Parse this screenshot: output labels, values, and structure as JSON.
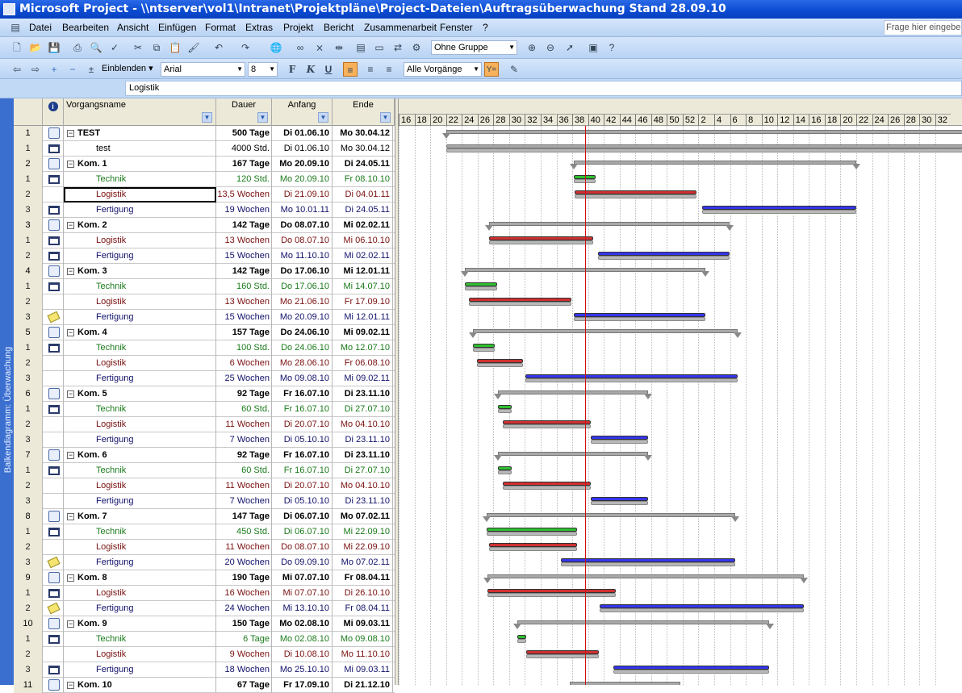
{
  "title": "Microsoft Project - \\\\ntserver\\vol1\\Intranet\\Projektpläne\\Project-Dateien\\Auftragsüberwachung Stand 28.09.10",
  "menu": [
    "Datei",
    "Bearbeiten",
    "Ansicht",
    "Einfügen",
    "Format",
    "Extras",
    "Projekt",
    "Bericht",
    "Zusammenarbeit",
    "Fenster",
    "?"
  ],
  "ask_placeholder": "Frage hier eingeben",
  "toolbar1": {
    "icons": [
      "new-icon",
      "open-icon",
      "save-icon",
      "print-icon",
      "print-preview-icon",
      "spellcheck-icon",
      "cut-icon",
      "copy-icon",
      "paste-icon",
      "format-painter-icon",
      "undo-icon",
      "redo-icon",
      "hyperlink-globe-icon",
      "link-tasks-icon",
      "unlink-tasks-icon",
      "split-task-icon",
      "task-info-icon",
      "task-notes-icon",
      "assign-resources-icon",
      "publish-icon"
    ],
    "group_value": "Ohne Gruppe",
    "icons_right": [
      "zoom-in-icon",
      "zoom-out-icon",
      "goto-task-icon",
      "copy-picture-icon",
      "help-icon"
    ]
  },
  "toolbar2": {
    "show_label": "Einblenden",
    "font_value": "Arial",
    "size_value": "8",
    "bold": "F",
    "italic": "K",
    "underline": "U",
    "filter_value": "Alle Vorgänge"
  },
  "entry_value": "Logistik",
  "view_label": "Balkendiagramm: Überwachung",
  "columns": {
    "name": "Vorgangsname",
    "duration": "Dauer",
    "start": "Anfang",
    "finish": "Ende"
  },
  "timescale": [
    "16",
    "18",
    "20",
    "22",
    "24",
    "26",
    "28",
    "30",
    "32",
    "34",
    "36",
    "38",
    "40",
    "42",
    "44",
    "46",
    "48",
    "50",
    "52",
    "2",
    "4",
    "6",
    "8",
    "10",
    "12",
    "14",
    "16",
    "18",
    "20",
    "22",
    "24",
    "26",
    "28",
    "30",
    "32"
  ],
  "colors": {
    "technik": "#2fbf2f",
    "logistik": "#d03030",
    "fertigung": "#3535ee",
    "summary": "#a8a8a8",
    "status_line": "#d01010"
  },
  "rows": [
    {
      "id": "1",
      "type": "summary",
      "icon": "sum",
      "name": "TEST",
      "duration": "500 Tage",
      "start": "Di 01.06.10",
      "finish": "Mo 30.04.12"
    },
    {
      "id": "1",
      "type": "plain",
      "icon": "cal",
      "name": "test",
      "duration": "4000 Std.",
      "start": "Di 01.06.10",
      "finish": "Mo 30.04.12"
    },
    {
      "id": "2",
      "type": "summary",
      "icon": "sum",
      "name": "Kom. 1",
      "duration": "167 Tage",
      "start": "Mo 20.09.10",
      "finish": "Di 24.05.11"
    },
    {
      "id": "1",
      "type": "technik",
      "icon": "cal",
      "name": "Technik",
      "duration": "120 Std.",
      "start": "Mo 20.09.10",
      "finish": "Fr 08.10.10"
    },
    {
      "id": "2",
      "type": "logistik",
      "icon": "",
      "name": "Logistik",
      "duration": "13,5 Wochen",
      "start": "Di 21.09.10",
      "finish": "Di 04.01.11",
      "selected": true
    },
    {
      "id": "3",
      "type": "fertigung",
      "icon": "cal",
      "name": "Fertigung",
      "duration": "19 Wochen",
      "start": "Mo 10.01.11",
      "finish": "Di 24.05.11"
    },
    {
      "id": "3",
      "type": "summary",
      "icon": "sum",
      "name": "Kom. 2",
      "duration": "142 Tage",
      "start": "Do 08.07.10",
      "finish": "Mi 02.02.11"
    },
    {
      "id": "1",
      "type": "logistik",
      "icon": "cal",
      "name": "Logistik",
      "duration": "13 Wochen",
      "start": "Do 08.07.10",
      "finish": "Mi 06.10.10"
    },
    {
      "id": "2",
      "type": "fertigung",
      "icon": "cal",
      "name": "Fertigung",
      "duration": "15 Wochen",
      "start": "Mo 11.10.10",
      "finish": "Mi 02.02.11"
    },
    {
      "id": "4",
      "type": "summary",
      "icon": "sum",
      "name": "Kom. 3",
      "duration": "142 Tage",
      "start": "Do 17.06.10",
      "finish": "Mi 12.01.11"
    },
    {
      "id": "1",
      "type": "technik",
      "icon": "cal",
      "name": "Technik",
      "duration": "160 Std.",
      "start": "Do 17.06.10",
      "finish": "Mi 14.07.10"
    },
    {
      "id": "2",
      "type": "logistik",
      "icon": "",
      "name": "Logistik",
      "duration": "13 Wochen",
      "start": "Mo 21.06.10",
      "finish": "Fr 17.09.10"
    },
    {
      "id": "3",
      "type": "fertigung",
      "icon": "note",
      "name": "Fertigung",
      "duration": "15 Wochen",
      "start": "Mo 20.09.10",
      "finish": "Mi 12.01.11"
    },
    {
      "id": "5",
      "type": "summary",
      "icon": "sum",
      "name": "Kom. 4",
      "duration": "157 Tage",
      "start": "Do 24.06.10",
      "finish": "Mi 09.02.11"
    },
    {
      "id": "1",
      "type": "technik",
      "icon": "cal",
      "name": "Technik",
      "duration": "100 Std.",
      "start": "Do 24.06.10",
      "finish": "Mo 12.07.10"
    },
    {
      "id": "2",
      "type": "logistik",
      "icon": "",
      "name": "Logistik",
      "duration": "6 Wochen",
      "start": "Mo 28.06.10",
      "finish": "Fr 06.08.10"
    },
    {
      "id": "3",
      "type": "fertigung",
      "icon": "",
      "name": "Fertigung",
      "duration": "25 Wochen",
      "start": "Mo 09.08.10",
      "finish": "Mi 09.02.11"
    },
    {
      "id": "6",
      "type": "summary",
      "icon": "sum",
      "name": "Kom. 5",
      "duration": "92 Tage",
      "start": "Fr 16.07.10",
      "finish": "Di 23.11.10"
    },
    {
      "id": "1",
      "type": "technik",
      "icon": "cal",
      "name": "Technik",
      "duration": "60 Std.",
      "start": "Fr 16.07.10",
      "finish": "Di 27.07.10"
    },
    {
      "id": "2",
      "type": "logistik",
      "icon": "",
      "name": "Logistik",
      "duration": "11 Wochen",
      "start": "Di 20.07.10",
      "finish": "Mo 04.10.10"
    },
    {
      "id": "3",
      "type": "fertigung",
      "icon": "",
      "name": "Fertigung",
      "duration": "7 Wochen",
      "start": "Di 05.10.10",
      "finish": "Di 23.11.10"
    },
    {
      "id": "7",
      "type": "summary",
      "icon": "sum",
      "name": "Kom. 6",
      "duration": "92 Tage",
      "start": "Fr 16.07.10",
      "finish": "Di 23.11.10"
    },
    {
      "id": "1",
      "type": "technik",
      "icon": "cal",
      "name": "Technik",
      "duration": "60 Std.",
      "start": "Fr 16.07.10",
      "finish": "Di 27.07.10"
    },
    {
      "id": "2",
      "type": "logistik",
      "icon": "",
      "name": "Logistik",
      "duration": "11 Wochen",
      "start": "Di 20.07.10",
      "finish": "Mo 04.10.10"
    },
    {
      "id": "3",
      "type": "fertigung",
      "icon": "",
      "name": "Fertigung",
      "duration": "7 Wochen",
      "start": "Di 05.10.10",
      "finish": "Di 23.11.10"
    },
    {
      "id": "8",
      "type": "summary",
      "icon": "sum",
      "name": "Kom. 7",
      "duration": "147 Tage",
      "start": "Di 06.07.10",
      "finish": "Mo 07.02.11"
    },
    {
      "id": "1",
      "type": "technik",
      "icon": "cal",
      "name": "Technik",
      "duration": "450 Std.",
      "start": "Di 06.07.10",
      "finish": "Mi 22.09.10"
    },
    {
      "id": "2",
      "type": "logistik",
      "icon": "",
      "name": "Logistik",
      "duration": "11 Wochen",
      "start": "Do 08.07.10",
      "finish": "Mi 22.09.10"
    },
    {
      "id": "3",
      "type": "fertigung",
      "icon": "note",
      "name": "Fertigung",
      "duration": "20 Wochen",
      "start": "Do 09.09.10",
      "finish": "Mo 07.02.11"
    },
    {
      "id": "9",
      "type": "summary",
      "icon": "sum",
      "name": "Kom. 8",
      "duration": "190 Tage",
      "start": "Mi 07.07.10",
      "finish": "Fr 08.04.11"
    },
    {
      "id": "1",
      "type": "logistik",
      "icon": "cal",
      "name": "Logistik",
      "duration": "16 Wochen",
      "start": "Mi 07.07.10",
      "finish": "Di 26.10.10"
    },
    {
      "id": "2",
      "type": "fertigung",
      "icon": "note",
      "name": "Fertigung",
      "duration": "24 Wochen",
      "start": "Mi 13.10.10",
      "finish": "Fr 08.04.11"
    },
    {
      "id": "10",
      "type": "summary",
      "icon": "sum",
      "name": "Kom. 9",
      "duration": "150 Tage",
      "start": "Mo 02.08.10",
      "finish": "Mi 09.03.11"
    },
    {
      "id": "1",
      "type": "technik",
      "icon": "cal",
      "name": "Technik",
      "duration": "6 Tage",
      "start": "Mo 02.08.10",
      "finish": "Mo 09.08.10"
    },
    {
      "id": "2",
      "type": "logistik",
      "icon": "",
      "name": "Logistik",
      "duration": "9 Wochen",
      "start": "Di 10.08.10",
      "finish": "Mo 11.10.10"
    },
    {
      "id": "3",
      "type": "fertigung",
      "icon": "cal",
      "name": "Fertigung",
      "duration": "18 Wochen",
      "start": "Mo 25.10.10",
      "finish": "Mi 09.03.11"
    },
    {
      "id": "11",
      "type": "summary",
      "icon": "sum",
      "name": "Kom. 10",
      "duration": "67 Tage",
      "start": "Fr 17.09.10",
      "finish": "Di 21.12.10"
    }
  ]
}
